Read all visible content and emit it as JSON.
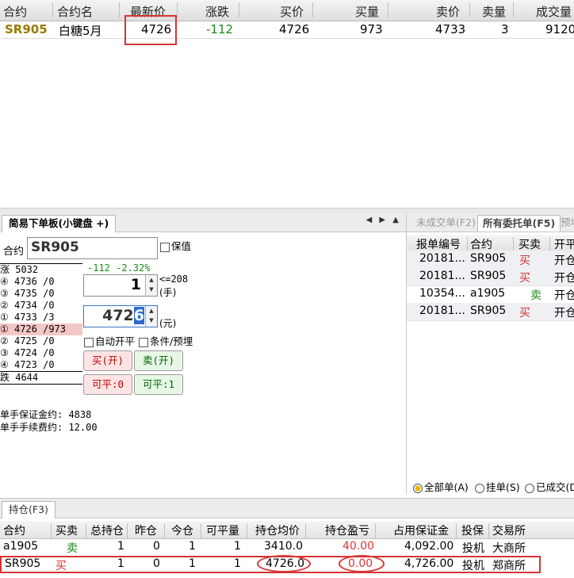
{
  "quote": {
    "headers": [
      "合约",
      "合约名",
      "最新价",
      "涨跌",
      "买价",
      "买量",
      "卖价",
      "卖量",
      "成交量"
    ],
    "row": {
      "code": "SR905",
      "name": "白糖5月",
      "last": "4726",
      "change": "-112",
      "bid": "4726",
      "bid_vol": "973",
      "ask": "4733",
      "ask_vol": "3",
      "volume": "9120"
    }
  },
  "order_panel": {
    "tab_label": "简易下单板(小键盘 +)",
    "nav_arrows": "◀ ▶ ▲",
    "contract_label": "合约",
    "contract_value": "SR905",
    "hedge_label": "保值",
    "change_text": "-112 -2.32%",
    "limit_up": "涨 5032",
    "limit_down": "跌 4644",
    "asks": [
      "④ 4736 /0",
      "③ 4735 /0",
      "② 4734 /0",
      "① 4733 /3"
    ],
    "bids": [
      "① 4726 /973",
      "② 4725 /0",
      "③ 4724 /0",
      "④ 4723 /0"
    ],
    "qty_value": "1",
    "qty_limit": "<=208",
    "qty_unit": "(手)",
    "price_value_main": "472",
    "price_value_sel": "6",
    "price_unit": "(元)",
    "auto_close": "自动开平",
    "condition": "条件/预埋",
    "buy_open": "买(开)",
    "sell_open": "卖(开)",
    "close_left": "可平:0",
    "close_right": "可平:1",
    "margin": "单手保证金约: 4838",
    "fee": "单手手续费约: 12.00"
  },
  "orders_panel": {
    "tabs": [
      "未成交单(F2)",
      "所有委托单(F5)",
      "预埋"
    ],
    "headers": [
      "报单编号",
      "合约",
      "买卖",
      "开平"
    ],
    "rows": [
      {
        "id": "20181...",
        "contract": "SR905",
        "side": "买",
        "oc": "开仓"
      },
      {
        "id": "20181...",
        "contract": "SR905",
        "side": "买",
        "oc": "开仓"
      },
      {
        "id": "10354...",
        "contract": "a1905",
        "side": "卖",
        "oc": "开仓"
      },
      {
        "id": "20181...",
        "contract": "SR905",
        "side": "买",
        "oc": "开仓"
      }
    ],
    "filters": [
      "全部单(A)",
      "挂单(S)",
      "已成交(D"
    ]
  },
  "positions": {
    "tab_label": "持仓(F3)",
    "headers": [
      "合约",
      "买卖",
      "总持仓",
      "昨仓",
      "今仓",
      "可平量",
      "持仓均价",
      "持仓盈亏",
      "占用保证金",
      "投保",
      "交易所"
    ],
    "rows": [
      {
        "contract": "a1905",
        "side": "卖",
        "total": "1",
        "yest": "0",
        "today": "1",
        "closable": "1",
        "avg": "3410.0",
        "pnl": "40.00",
        "margin": "4,092.00",
        "hedge": "投机",
        "exchange": "大商所"
      },
      {
        "contract": "SR905",
        "side": "买",
        "total": "1",
        "yest": "0",
        "today": "1",
        "closable": "1",
        "avg": "4726.0",
        "pnl": "0.00",
        "margin": "4,726.00",
        "hedge": "投机",
        "exchange": "郑商所"
      }
    ]
  },
  "colors": {
    "up_red": "#d73434",
    "down_green": "#1a8a1a",
    "code_gold": "#9a7a00",
    "highlight": "#d73434"
  }
}
